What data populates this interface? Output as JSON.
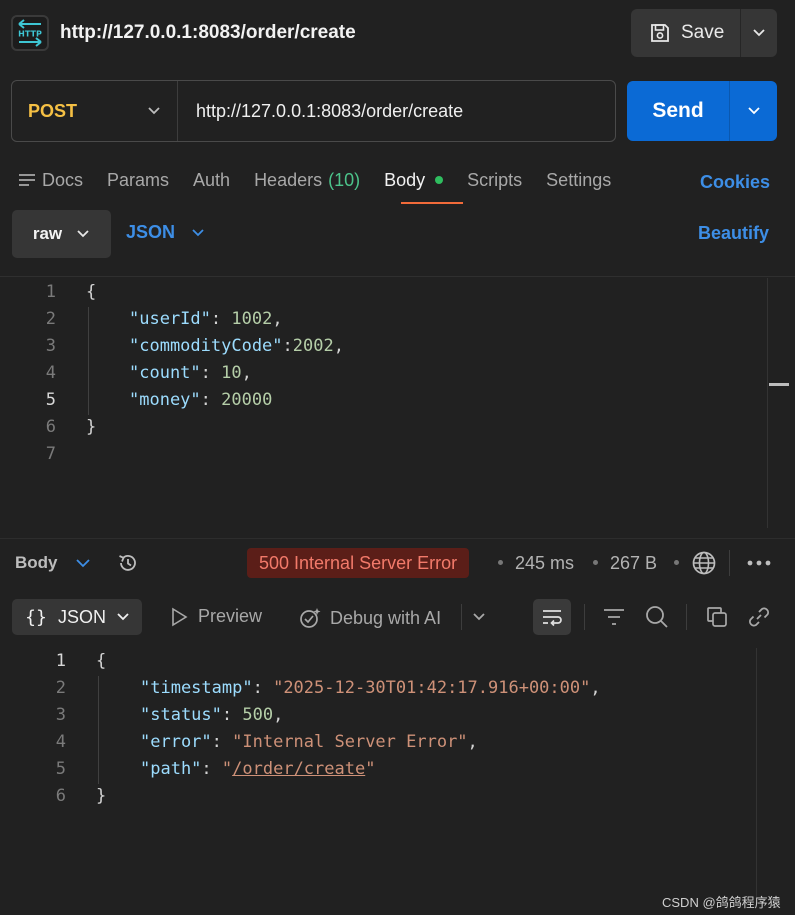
{
  "header": {
    "icon_text": "HTTP",
    "title": "http://127.0.0.1:8083/order/create",
    "save_label": "Save"
  },
  "request": {
    "method": "POST",
    "url": "http://127.0.0.1:8083/order/create",
    "send_label": "Send"
  },
  "tabs": {
    "docs": "Docs",
    "params": "Params",
    "auth": "Auth",
    "headers": "Headers",
    "headers_count": "(10)",
    "body": "Body",
    "scripts": "Scripts",
    "settings": "Settings",
    "active": "Body"
  },
  "cookies_label": "Cookies",
  "body_mode": {
    "mode": "raw",
    "format": "JSON",
    "beautify_label": "Beautify"
  },
  "request_body": {
    "line_numbers": [
      "1",
      "2",
      "3",
      "4",
      "5",
      "6",
      "7"
    ],
    "open_brace": "{",
    "close_brace": "}",
    "fields": [
      {
        "key": "\"userId\"",
        "sep": ": ",
        "value": "1002",
        "comma": ","
      },
      {
        "key": "\"commodityCode\"",
        "sep": ":",
        "value": "2002",
        "comma": ","
      },
      {
        "key": "\"count\"",
        "sep": ": ",
        "value": "10",
        "comma": ","
      },
      {
        "key": "\"money\"",
        "sep": ": ",
        "value": "20000",
        "comma": ""
      }
    ]
  },
  "response": {
    "body_label": "Body",
    "status": "500 Internal Server Error",
    "time": "245 ms",
    "size": "267 B",
    "format_label": "JSON",
    "preview_label": "Preview",
    "debug_label": "Debug with AI",
    "line_numbers": [
      "1",
      "2",
      "3",
      "4",
      "5",
      "6"
    ],
    "open_brace": "{",
    "close_brace": "}",
    "fields": [
      {
        "key": "\"timestamp\"",
        "value": "\"2025-12-30T01:42:17.916+00:00\"",
        "comma": ","
      },
      {
        "key": "\"status\"",
        "value": "500",
        "comma": ","
      },
      {
        "key": "\"error\"",
        "value": "\"Internal Server Error\"",
        "comma": ","
      },
      {
        "key": "\"path\"",
        "value": "\"/order/create\"",
        "comma": ""
      }
    ],
    "path_quote_open": "\"",
    "path_value": "/order/create",
    "path_quote_close": "\""
  },
  "watermark": "CSDN @鸽鸽程序猿",
  "colors": {
    "accent_blue": "#0b6ad5",
    "method_post": "#f5c044",
    "error_badge_bg": "#5b1e18",
    "error_badge_text": "#f27a6a",
    "active_tab_underline": "#f26b3a"
  }
}
